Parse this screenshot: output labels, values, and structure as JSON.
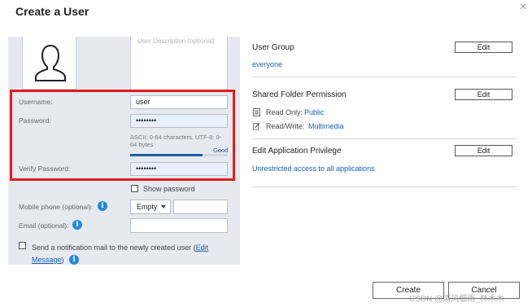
{
  "dialog": {
    "title": "Create a User"
  },
  "left": {
    "description_placeholder": "User Description (optional)",
    "username_label": "Username:",
    "username_value": "user",
    "password_label": "Password:",
    "password_value": "••••••••",
    "password_hint": "ASCII: 0-64 characters, UTF-8: 0-64 bytes",
    "strength_label": "Good",
    "strength_level": 0.74,
    "verify_label": "Verify Password:",
    "verify_value": "••••••••",
    "show_password_label": "Show password",
    "mobile_label": "Mobile phone (optional):",
    "mobile_country": "Empty",
    "email_label": "Email (optional):",
    "notify_text": "Send a notification mail to the newly created user (",
    "notify_link_1": "Edit",
    "notify_link_2": "Message",
    "notify_close": ")"
  },
  "right": {
    "user_group_title": "User Group",
    "user_group_value": "everyone",
    "shared_folder_title": "Shared Folder Permission",
    "read_only_label": "Read Only:",
    "read_only_value": "Public",
    "read_write_label": "Read/Write:",
    "read_write_value": "Multimedia",
    "app_privilege_title": "Edit Application Privilege",
    "app_privilege_value": "Unrestricted access to all applications",
    "edit_label": "Edit"
  },
  "footer": {
    "create_label": "Create",
    "cancel_label": "Cancel",
    "watermark": "CSDN @清风细雨_林木木"
  },
  "colors": {
    "accent": "#1a5fb4",
    "highlight_frame": "#e21b1b",
    "panel_bg": "#e6e9ef"
  }
}
